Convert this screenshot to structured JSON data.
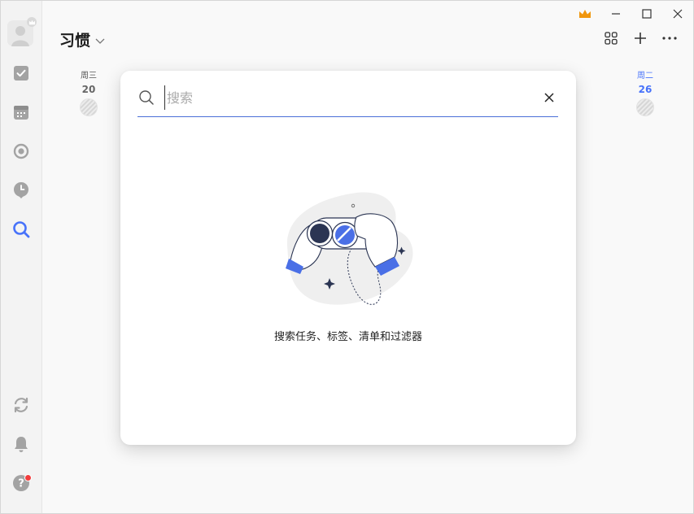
{
  "header": {
    "title": "习惯"
  },
  "days": [
    {
      "name": "周三",
      "num": "20",
      "today": false
    },
    {
      "name": "周二",
      "num": "26",
      "today": true
    }
  ],
  "search": {
    "placeholder": "搜索",
    "value": "",
    "empty_hint": "搜索任务、标签、清单和过滤器"
  },
  "colors": {
    "accent": "#4772fa",
    "premium": "#f0960e",
    "notification": "#f23d3d"
  },
  "icons": {
    "sidebar": [
      "avatar",
      "checkbox-icon",
      "calendar-icon",
      "focus-icon",
      "clock-icon",
      "search-icon",
      "sync-icon",
      "bell-icon",
      "help-icon"
    ],
    "toolbar": [
      "grid-icon",
      "plus-icon",
      "more-icon"
    ],
    "window": [
      "crown-icon",
      "minimize-icon",
      "maximize-icon",
      "close-icon"
    ]
  }
}
